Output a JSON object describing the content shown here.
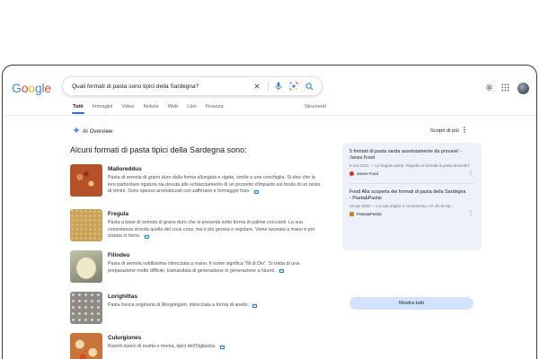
{
  "header": {
    "logo_letters": [
      {
        "ch": "G",
        "color": "#4285F4"
      },
      {
        "ch": "o",
        "color": "#EA4335"
      },
      {
        "ch": "o",
        "color": "#FBBC05"
      },
      {
        "ch": "g",
        "color": "#4285F4"
      },
      {
        "ch": "l",
        "color": "#34A853"
      },
      {
        "ch": "e",
        "color": "#EA4335"
      }
    ],
    "search_value": "Quali formati di pasta sono tipici della Sardegna?",
    "icons": [
      "clear-icon",
      "microphone-icon",
      "lens-icon",
      "search-icon",
      "settings-icon",
      "apps-grid-icon"
    ]
  },
  "tabs": {
    "items": [
      {
        "label": "Tutti",
        "active": true
      },
      {
        "label": "Immagini",
        "active": false
      },
      {
        "label": "Video",
        "active": false
      },
      {
        "label": "Notizie",
        "active": false
      },
      {
        "label": "Web",
        "active": false
      },
      {
        "label": "Libri",
        "active": false
      },
      {
        "label": "Finanza",
        "active": false
      }
    ],
    "tools": "Strumenti"
  },
  "ai": {
    "label": "AI Overview",
    "learn_more": "Scopri di più",
    "title": "Alcuni formati di pasta tipici della Sardegna sono:",
    "items": [
      {
        "name": "Malloreddus",
        "desc": "Pasta di semola di grano duro dalla forma allungata e rigata, simile a una conchiglia. Si dice che la loro particolare rigatura sia dovuta allo schiacciamento di un pezzetto d'impasto sul fondo di un cesto di vimini. Sono spesso aromatizzati con zafferano e formaggio fuso.",
        "thumb_color": "#b5522a"
      },
      {
        "name": "Fregula",
        "desc": "Pasta a base di semola di grano duro che si presenta sotto forma di palline croccanti. La sua consistenza ricorda quella del cous cous, ma è più grossa e regolare. Viene lavorata a mano e poi tostata in forno.",
        "thumb_color": "#c9a15a"
      },
      {
        "name": "Filindeu",
        "desc": "Pasta di semola sottilissima intrecciata a mano. Il nome significa \"fili di Dio\". Si tratta di una preparazione molto difficile, tramandata di generazione in generazione a Nuoro.",
        "thumb_color": "#a8a890"
      },
      {
        "name": "Lorighittas",
        "desc": "Pasta fresca originaria di Morgongiori, intrecciata a forma di anello.",
        "thumb_color": "#8e8b86"
      },
      {
        "name": "Culurgiones",
        "desc": "Ravioli ripieni di ricotta e menta, tipici dell'Ogliastra.",
        "thumb_color": "#c9743a"
      }
    ]
  },
  "panel": {
    "sources": [
      {
        "title": "5 formati di pasta sarda assolutamente da provare! - Janes Food",
        "meta": "9 nov 2021 — La fregula sarda. Rispetto ai formati di pasta descritti fino...",
        "site": "Janes Food",
        "fav_color": "#d93025"
      },
      {
        "title": "Food Alla scoperta dei formati di pasta della Sardegna - Pasta&Pastai",
        "meta": "18 apr 2022 — La sua origine è controversa: c'è chi la rep...",
        "site": "Pasta&Pastai",
        "fav_color": "#c58a1a"
      }
    ],
    "show_all": "Mostra tutti"
  }
}
